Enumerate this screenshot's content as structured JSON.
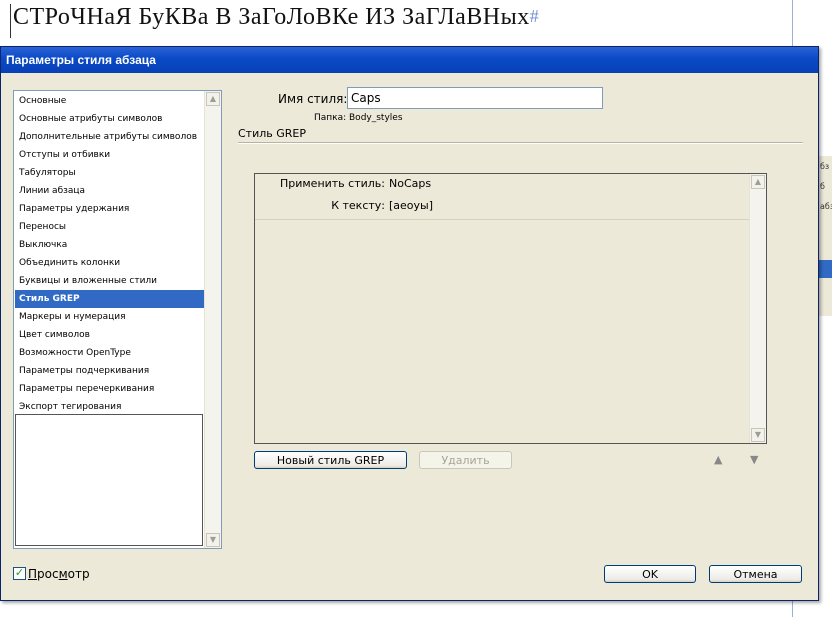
{
  "document": {
    "heading_text": "СТРоЧНаЯ БуКВа В ЗаГоЛоВКе ИЗ ЗаГЛаВНых",
    "pilcrow": "#",
    "side_panel_labels": [
      "бз",
      "б",
      "абз"
    ]
  },
  "dialog": {
    "title": "Параметры стиля абзаца",
    "categories": [
      "Основные",
      "Основные атрибуты символов",
      "Дополнительные атрибуты символов",
      "Отступы и отбивки",
      "Табуляторы",
      "Линии абзаца",
      "Параметры удержания",
      "Переносы",
      "Выключка",
      "Объединить колонки",
      "Буквицы и вложенные стили",
      "Стиль GREP",
      "Маркеры и нумерация",
      "Цвет символов",
      "Возможности OpenType",
      "Параметры подчеркивания",
      "Параметры перечеркивания",
      "Экспорт тегирования"
    ],
    "selected_category": "Стиль GREP",
    "style_name_label": "Имя стиля:",
    "style_name_value": "Caps",
    "folder_label": "Папка: Body_styles",
    "section_title": "Стиль GREP",
    "grep_rule": {
      "apply_label": "Применить стиль:",
      "apply_value": "NoCaps",
      "to_text_label": "К тексту:",
      "to_text_value": "[аеоуы]"
    },
    "new_grep_button": "Новый стиль GREP",
    "delete_button": "Удалить",
    "preview_label": "Просмотр",
    "preview_checked": true,
    "ok_button": "OK",
    "cancel_button": "Отмена"
  },
  "icons": {
    "scroll_up": "scroll-up-arrow-icon",
    "scroll_down": "scroll-down-arrow-icon",
    "move_up": "move-up-triangle-icon",
    "move_down": "move-down-triangle-icon",
    "checkmark": "checkmark-icon"
  },
  "colors": {
    "titlebar": "#0a4ac6",
    "selection": "#316ac5",
    "dialog_bg": "#ece9d8"
  }
}
